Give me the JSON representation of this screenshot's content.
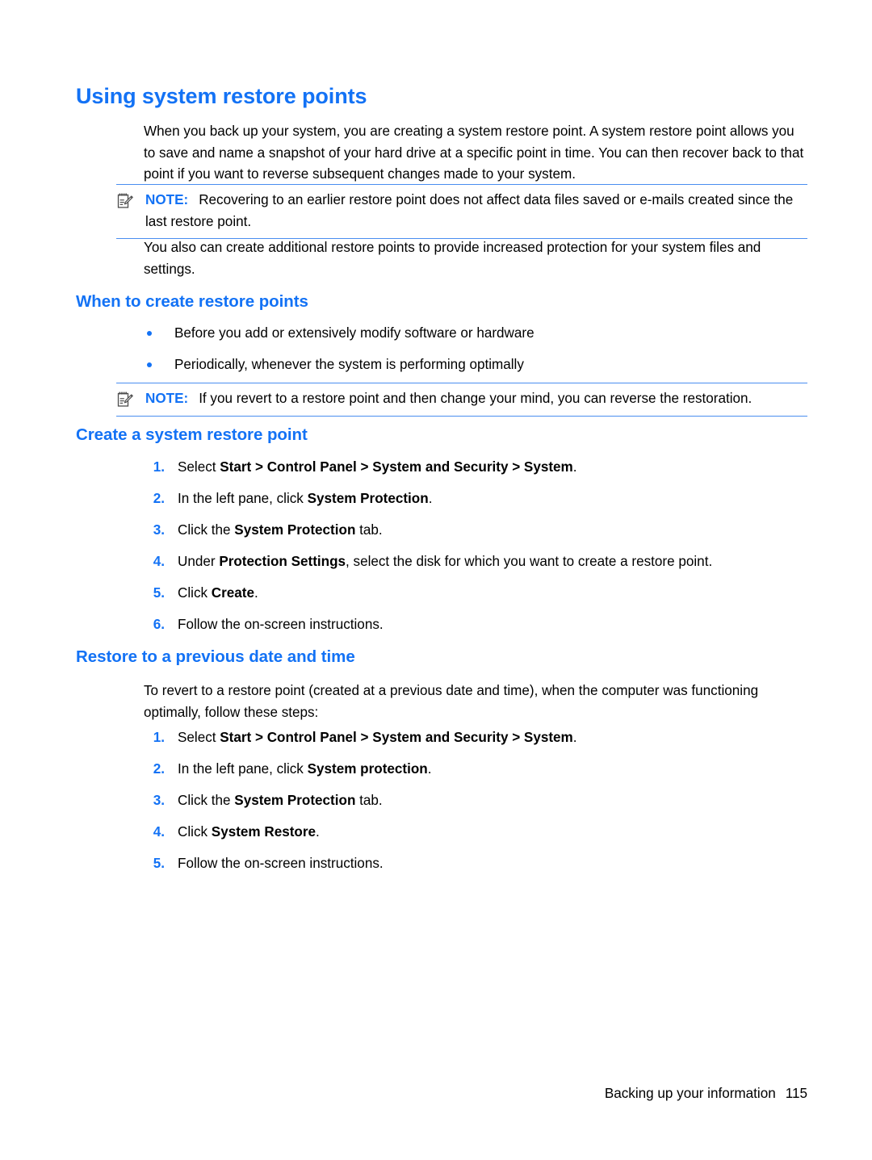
{
  "page": {
    "title": "Using system restore points",
    "intro_paragraph": "When you back up your system, you are creating a system restore point. A system restore point allows you to save and name a snapshot of your hard drive at a specific point in time. You can then recover back to that point if you want to reverse subsequent changes made to your system.",
    "second_paragraph": "You also can create additional restore points to provide increased protection for your system files and settings."
  },
  "notes": [
    {
      "icon": "note-pad-pencil-icon",
      "label": "NOTE:",
      "text": "Recovering to an earlier restore point does not affect data files saved or e-mails created since the last restore point."
    },
    {
      "icon": "note-pad-pencil-icon",
      "label": "NOTE:",
      "text": "If you revert to a restore point and then change your mind, you can reverse the restoration."
    }
  ],
  "sections": {
    "when_to_create": {
      "heading": "When to create restore points",
      "bullets": [
        "Before you add or extensively modify software or hardware",
        "Periodically, whenever the system is performing optimally"
      ]
    },
    "create_point": {
      "heading": "Create a system restore point",
      "steps": [
        {
          "num": "1.",
          "pre": "Select ",
          "bold": "Start > Control Panel > System and Security > System",
          "post": "."
        },
        {
          "num": "2.",
          "pre": "In the left pane, click ",
          "bold": "System Protection",
          "post": "."
        },
        {
          "num": "3.",
          "pre": "Click the ",
          "bold": "System Protection",
          "post": " tab."
        },
        {
          "num": "4.",
          "pre": "Under ",
          "bold": "Protection Settings",
          "post": ", select the disk for which you want to create a restore point."
        },
        {
          "num": "5.",
          "pre": "Click ",
          "bold": "Create",
          "post": "."
        },
        {
          "num": "6.",
          "pre": "Follow the on-screen instructions.",
          "bold": "",
          "post": ""
        }
      ]
    },
    "restore_previous": {
      "heading": "Restore to a previous date and time",
      "intro": "To revert to a restore point (created at a previous date and time), when the computer was functioning optimally, follow these steps:",
      "steps": [
        {
          "num": "1.",
          "pre": "Select ",
          "bold": "Start > Control Panel > System and Security > System",
          "post": "."
        },
        {
          "num": "2.",
          "pre": "In the left pane, click ",
          "bold": "System protection",
          "post": "."
        },
        {
          "num": "3.",
          "pre": "Click the ",
          "bold": "System Protection",
          "post": " tab."
        },
        {
          "num": "4.",
          "pre": "Click ",
          "bold": "System Restore",
          "post": "."
        },
        {
          "num": "5.",
          "pre": "Follow the on-screen instructions.",
          "bold": "",
          "post": ""
        }
      ]
    }
  },
  "footer": {
    "text": "Backing up your information",
    "page_number": "115"
  },
  "colors": {
    "heading_blue": "#1372f5",
    "rule_blue": "#4a8ef0",
    "body_black": "#000000"
  }
}
